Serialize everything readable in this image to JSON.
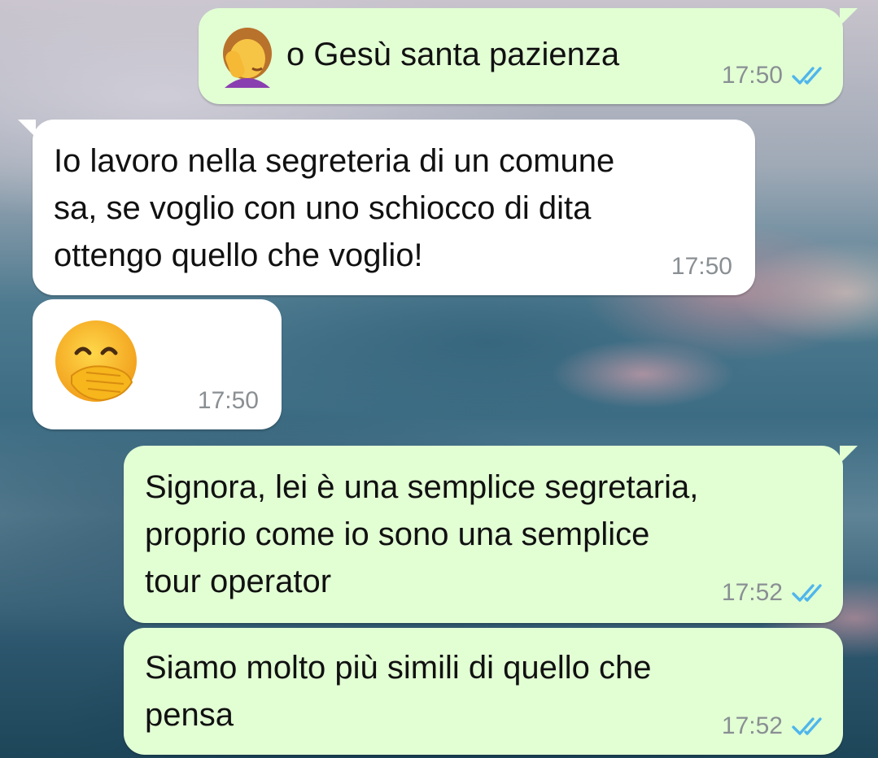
{
  "chat": {
    "messages": [
      {
        "direction": "outgoing",
        "emoji": "woman-facepalming",
        "text": "o Gesù santa pazienza",
        "time": "17:50",
        "status": "read"
      },
      {
        "direction": "incoming",
        "text": "Io lavoro nella segreteria di un comune\nsa, se voglio con uno schiocco di dita\nottengo quello che voglio!",
        "time": "17:50"
      },
      {
        "direction": "incoming",
        "emoji": "face-with-hand-over-mouth",
        "time": "17:50"
      },
      {
        "direction": "outgoing",
        "text": "Signora, lei è una semplice segretaria,\nproprio come io sono una semplice\ntour operator",
        "time": "17:52",
        "status": "read"
      },
      {
        "direction": "outgoing",
        "text": "Siamo molto più simili di quello che\npensa",
        "time": "17:52",
        "status": "read"
      }
    ]
  },
  "colors": {
    "outgoing_bubble": "#e2ffd4",
    "incoming_bubble": "#ffffff",
    "read_ticks": "#4fb6ec",
    "timestamp": "#8a8f93"
  }
}
